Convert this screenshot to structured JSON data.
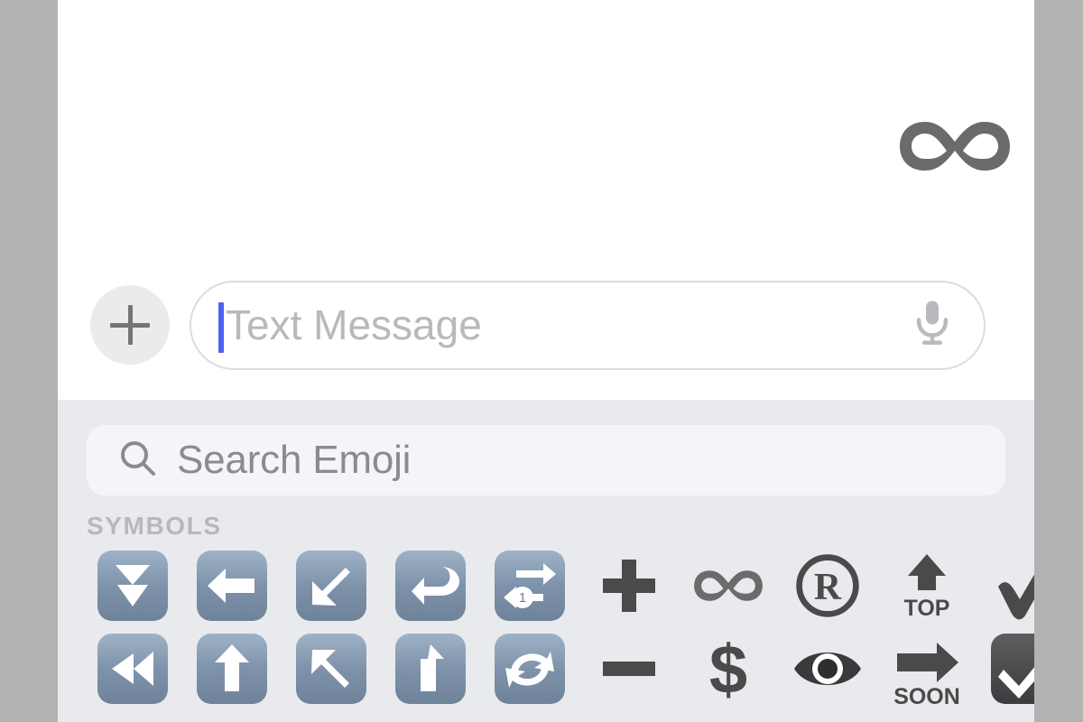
{
  "app": {
    "name": "Messages",
    "screen": "conversation-with-emoji-keyboard"
  },
  "colors": {
    "letterbox_gray": "#b2b2b3",
    "conversation_bg": "#ffffff",
    "keyboard_bg": "#e9eaee",
    "search_bar_bg": "#f4f5f8",
    "plus_button_bg": "#ebebed",
    "placeholder_text": "#b9b9bc",
    "caret_blue": "#4d62ed",
    "section_title": "#b6b8bd",
    "emoji_blue_key": "#7a90a8",
    "emoji_dark": "#4a4a4a"
  },
  "conversation": {
    "sent_messages": [
      {
        "content": "♾️",
        "icon_name": "infinity-emoji",
        "align": "right"
      }
    ]
  },
  "input_bar": {
    "plus_button_label": "+",
    "plus_button_name": "add-attachment-button",
    "text_field": {
      "value": "",
      "placeholder": "Text Message",
      "caret_visible": true,
      "mic_icon": "microphone-icon"
    }
  },
  "emoji_keyboard": {
    "search": {
      "placeholder": "Search Emoji",
      "value": "",
      "icon": "search-icon"
    },
    "section_title": "SYMBOLS",
    "columns": 10,
    "rows": [
      [
        {
          "char": "⏬",
          "name": "fast-down-button-emoji",
          "style": "key"
        },
        {
          "char": "⬅️",
          "name": "left-arrow-emoji",
          "style": "key"
        },
        {
          "char": "↙️",
          "name": "down-left-arrow-emoji",
          "style": "key"
        },
        {
          "char": "↩️",
          "name": "right-arrow-curving-left-emoji",
          "style": "key"
        },
        {
          "char": "🔂",
          "name": "repeat-single-button-emoji",
          "style": "key"
        },
        {
          "char": "➕",
          "name": "plus-emoji",
          "style": "plain"
        },
        {
          "char": "♾️",
          "name": "infinity-emoji",
          "style": "plain"
        },
        {
          "char": "®️",
          "name": "registered-emoji",
          "style": "plain"
        },
        {
          "char": "🔝",
          "name": "top-arrow-emoji",
          "style": "plain"
        },
        {
          "char": "✔️",
          "name": "check-mark-emoji",
          "style": "plain"
        }
      ],
      [
        {
          "char": "⏪",
          "name": "fast-reverse-button-emoji",
          "style": "key"
        },
        {
          "char": "⬆️",
          "name": "up-arrow-emoji",
          "style": "key"
        },
        {
          "char": "↖️",
          "name": "up-left-arrow-emoji",
          "style": "key"
        },
        {
          "char": "⤴️",
          "name": "right-arrow-curving-up-emoji",
          "style": "key"
        },
        {
          "char": "🔄",
          "name": "counterclockwise-arrows-emoji",
          "style": "key"
        },
        {
          "char": "➖",
          "name": "minus-emoji",
          "style": "plain"
        },
        {
          "char": "💲",
          "name": "heavy-dollar-sign-emoji",
          "style": "plain"
        },
        {
          "char": "👁",
          "name": "eye-emoji",
          "style": "plain"
        },
        {
          "char": "🔜",
          "name": "soon-arrow-emoji",
          "style": "plain"
        },
        {
          "char": "✅",
          "name": "check-mark-button-emoji",
          "style": "plain"
        }
      ]
    ],
    "soon_label": "SOON",
    "top_label": "TOP"
  }
}
